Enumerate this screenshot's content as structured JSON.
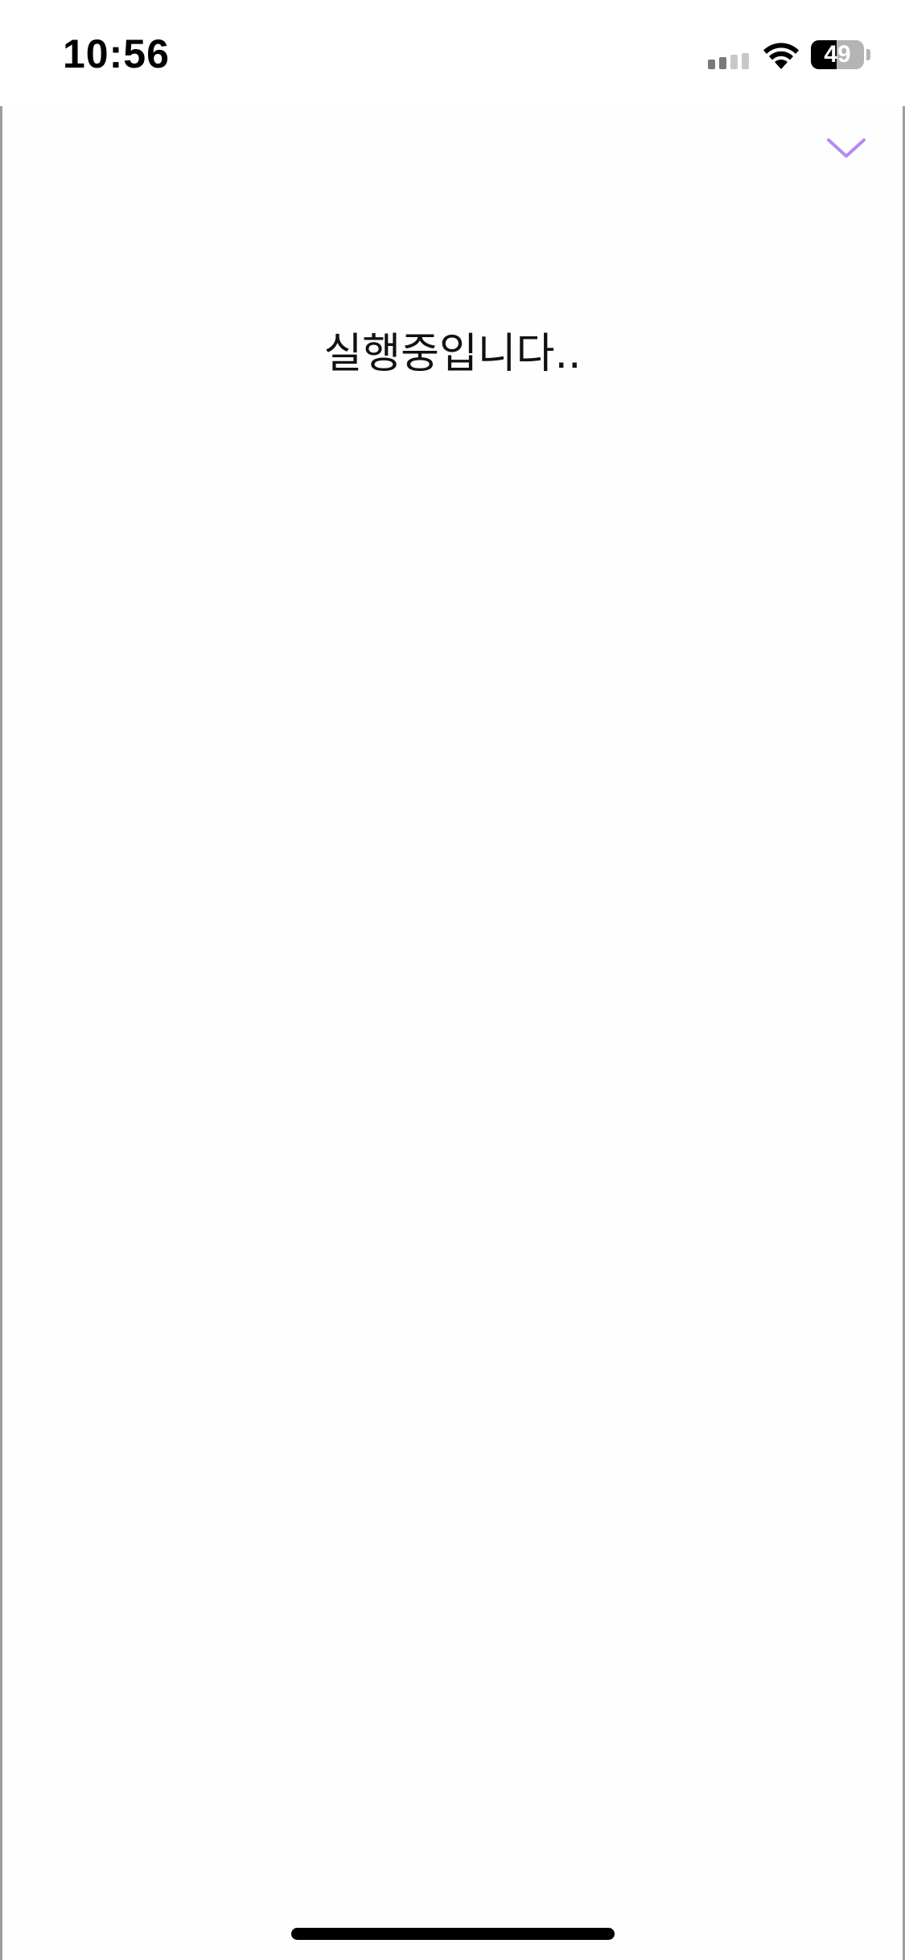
{
  "status_bar": {
    "time": "10:56",
    "battery_level": "49",
    "battery_fraction": 0.49,
    "signal_bars_active": 2,
    "signal_bars_total": 4
  },
  "sheet": {
    "message": "실행중입니다..",
    "dismiss_icon": "chevron-down-icon",
    "accent_color": "#b28cf2"
  },
  "colors": {
    "signal_active": "#7a7a7a",
    "signal_inactive": "#c8c8c8",
    "battery_fill": "#000000",
    "battery_empty": "#b4b4b4"
  }
}
